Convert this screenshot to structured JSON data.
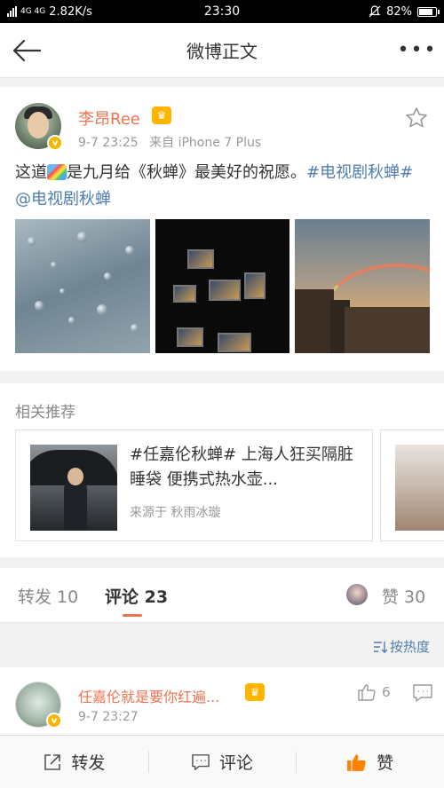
{
  "status_bar": {
    "network": "4G 4G",
    "speed": "2.82K/s",
    "time": "23:30",
    "battery": "82%",
    "battery_level": 0.82
  },
  "nav": {
    "title": "微博正文",
    "back_icon": "arrow-left-icon",
    "more_label": "•••"
  },
  "post": {
    "author": "李昂Ree",
    "date": "9-7 23:25",
    "source": "来自 iPhone 7 Plus",
    "text_before": "这道",
    "text_after": "是九月给《秋蝉》最美好的祝愿。",
    "hashtag": "#电视剧秋蝉#",
    "mention": "@电视剧秋蝉",
    "verified_badge": "v"
  },
  "related": {
    "title": "相关推荐",
    "card": {
      "text": "#任嘉伦秋蝉# 上海人狂买隔脏睡袋 便携式热水壶...",
      "source": "来源于 秋雨冰璇"
    }
  },
  "tabs": {
    "repost": "转发 10",
    "comment": "评论 23",
    "like": "赞 30"
  },
  "sort": {
    "label": "按热度"
  },
  "comment": {
    "name": "任嘉伦就是要你红遍...",
    "time": "9-7 23:27",
    "likes": "6"
  },
  "bottom_bar": {
    "repost": "转发",
    "comment": "评论",
    "like": "赞"
  },
  "colors": {
    "accent": "#eb7350",
    "link": "#507daf"
  }
}
